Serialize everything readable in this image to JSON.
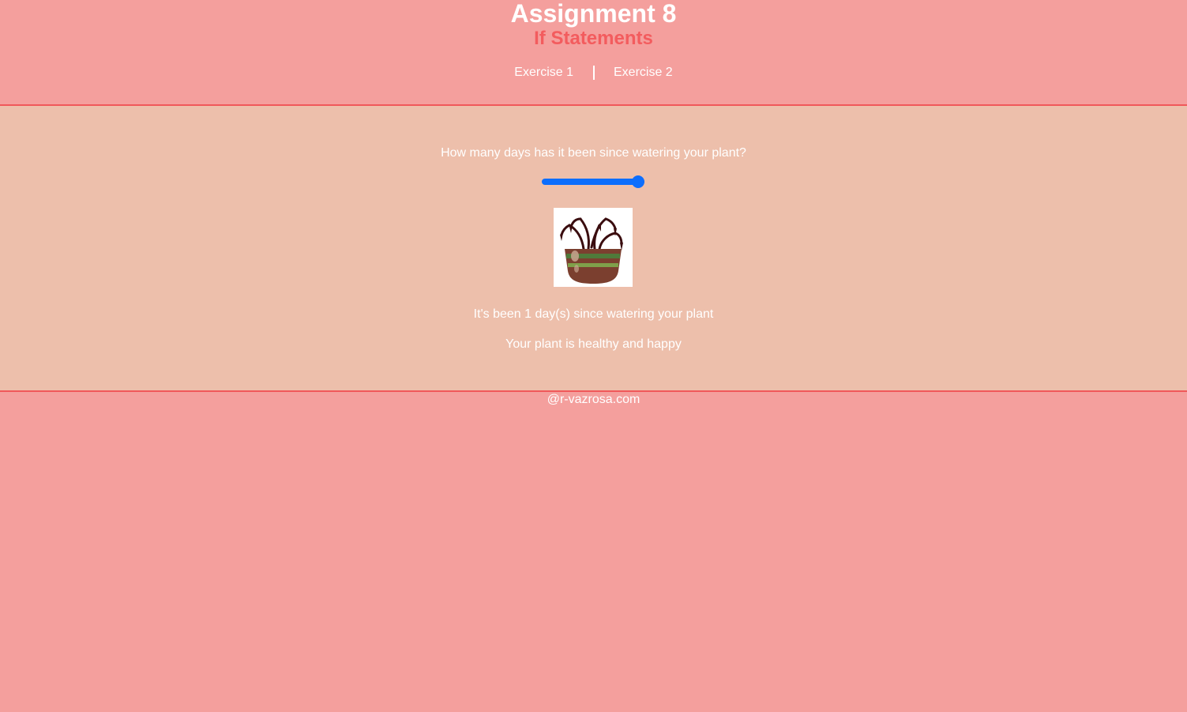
{
  "header": {
    "title": "Assignment 8",
    "subtitle": "If Statements",
    "nav": [
      "Exercise 1",
      "Exercise 2"
    ]
  },
  "main": {
    "question": "How many days has it been since watering your plant?",
    "slider": {
      "value": 1,
      "min": 0,
      "max": 1,
      "accent_color": "#0d6efd"
    },
    "plant_image": "wilted-plant-in-pot",
    "status_days": "It's been 1 day(s) since watering your plant",
    "status_health": "Your plant is healthy and happy"
  },
  "footer": {
    "text": "@r-vazrosa.com"
  },
  "colors": {
    "page_bg": "#f49f9d",
    "content_bg": "#edbfab",
    "border": "#f0585a",
    "subtitle": "#f35c5e",
    "text": "#ffffff"
  }
}
